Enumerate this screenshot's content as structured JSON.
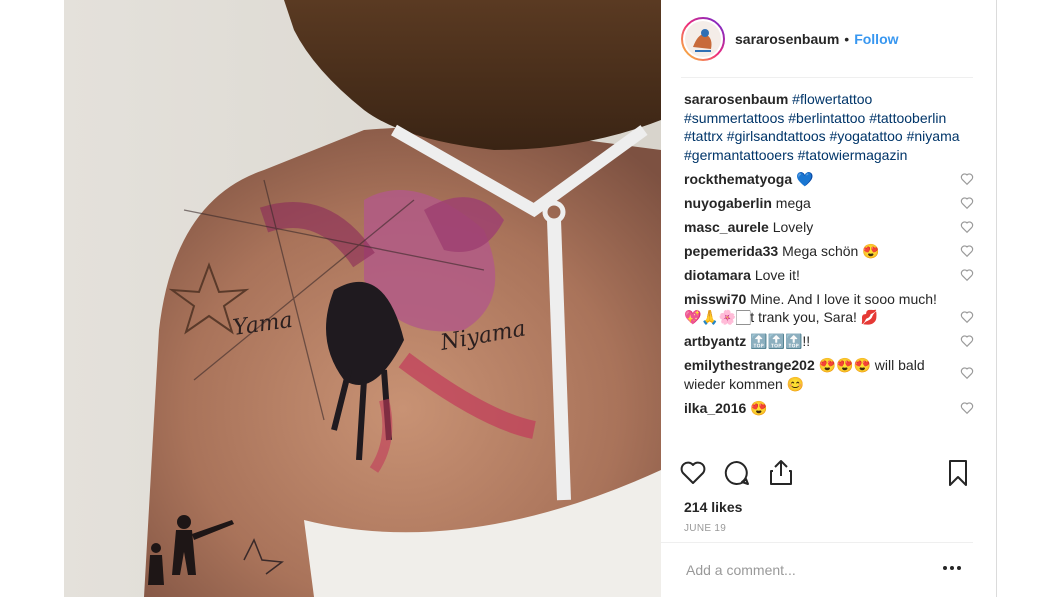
{
  "post": {
    "username": "sararosenbaum",
    "separator": "•",
    "follow_label": "Follow",
    "caption_user": "sararosenbaum",
    "caption_tags": [
      "#flowertattoo",
      "#summertattoos",
      "#berlintattoo",
      "#tattooberlin",
      "#tattrx",
      "#girlsandtattoos",
      "#yogatattoo",
      "#niyama",
      "#germantattooers",
      "#tatowiermagazin"
    ],
    "likes": "214 likes",
    "date": "JUNE 19",
    "add_comment_placeholder": "Add a comment...",
    "tattoo_text_left": "Yama",
    "tattoo_text_right": "Niyama"
  },
  "comments": [
    {
      "user": "rockthematyoga",
      "text": "💙"
    },
    {
      "user": "nuyogaberlin",
      "text": "mega"
    },
    {
      "user": "masc_aurele",
      "text": "Lovely"
    },
    {
      "user": "pepemerida33",
      "text": "Mega schön 😍"
    },
    {
      "user": "diotamara",
      "text": "Love it!"
    },
    {
      "user": "misswi70",
      "text": "Mine. And I love it sooo much! 💖🙏🌸🏻t    trank you, Sara! 💋"
    },
    {
      "user": "artbyantz",
      "text": "🔝🔝🔝!!"
    },
    {
      "user": "emilythestrange202",
      "text": "😍😍😍 will bald wieder kommen 😊"
    },
    {
      "user": "ilka_2016",
      "text": "😍"
    }
  ],
  "icons": {
    "like": "heart-icon",
    "comment": "speech-bubble-icon",
    "share": "share-icon",
    "save": "bookmark-icon",
    "more": "ellipsis-icon",
    "comment_like": "small-heart-icon"
  },
  "colors": {
    "link": "#3897f0",
    "hashtag": "#003569",
    "text": "#262626",
    "muted": "#999999"
  }
}
